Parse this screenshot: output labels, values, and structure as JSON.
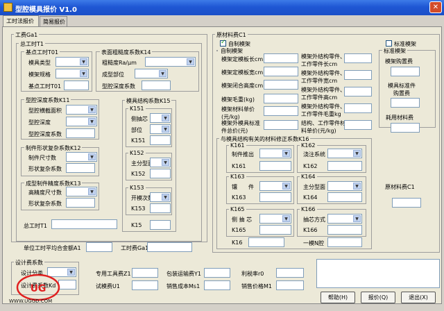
{
  "window": {
    "title": "型腔模具报价 V1.0",
    "close_glyph": "✕"
  },
  "tabs": [
    "工时法报价",
    "简易报价"
  ],
  "hours": {
    "group": "工费Ga1",
    "total": "总工时T1",
    "basic": {
      "group": "基点工时T01",
      "mold_type": "模具类型",
      "mold_spec": "模架规格",
      "base_hours": "基点工时T01"
    },
    "rough": {
      "group": "表面粗糙度系数K14",
      "roughness": "粗糙度Ra/μm",
      "cavity_part": "成型部位",
      "coef": "型腔深度系数"
    },
    "depth": {
      "group": "型腔深度系数K11",
      "area": "型腔横截面积",
      "depth": "型腔深度",
      "coef": "型腔深度系数"
    },
    "mfg": {
      "group": "制件形状复杂系数K12",
      "size": "制件尺寸数",
      "coef": "形状复杂系数"
    },
    "precision": {
      "group": "成型制件精度系数K13",
      "dims": "高精度尺寸数",
      "coef": "形状复杂系数"
    },
    "struct": {
      "group": "模具结构系数K15",
      "k151": {
        "group": "K151",
        "a": "侧抽芯",
        "b": "部位",
        "c": "K151"
      },
      "k152": {
        "group": "K152",
        "a": "主分型面",
        "b": "K152"
      },
      "k153": {
        "group": "K153",
        "a": "开模次数",
        "b": "K153"
      },
      "k15": "K15"
    },
    "total_label": "总工时T1",
    "avg_cost": "单位工时平均合金额A1",
    "fee_label": "工时费Ga1"
  },
  "material": {
    "group": "原材料费C1",
    "self_chk": "自制模架",
    "std_chk": "标准模架",
    "self": {
      "group": "自制模架",
      "len": "模架定模板长cm",
      "wid": "模架定模板宽cm",
      "h": "模架闭合高度cm",
      "wt": "模架毛重(kg)",
      "price": "模架材料单价(元/kg)",
      "total": "模架外模具标准件总价(元)"
    },
    "ext": {
      "len": "模架外结构零件、工作零件长cm",
      "wid": "模架外结构零件、工作零件宽cm",
      "h": "模架外结构零件、工作零件高cm",
      "wt": "模架外结构零件、工作零件毛重kg",
      "price": "结构、工作零件材料单价(元/kg)"
    },
    "std": {
      "group": "标准模架",
      "buy": "模架购置费",
      "parts": "模具标准件购置费",
      "use": "耗用材料费"
    },
    "k16": {
      "group": "与模具结构有关的材料修正系数K16",
      "k161": {
        "g": "K161",
        "a": "制件推出",
        "b": "K161"
      },
      "k162": {
        "g": "K162",
        "a": "浇注系统",
        "b": "K162"
      },
      "k163": {
        "g": "K163",
        "a": "镶　　件",
        "b": "K163"
      },
      "k164": {
        "g": "K164",
        "a": "主分型面",
        "b": "K164"
      },
      "k165": {
        "g": "K165",
        "a": "侧 抽 芯",
        "b": "K165"
      },
      "k166": {
        "g": "K166",
        "a": "抽芯方式",
        "b": "K166"
      },
      "k16": "K16",
      "cav": "一模N腔"
    },
    "fee": "原材料费C1"
  },
  "design": {
    "group": "设计费系数",
    "cls": "设计分类",
    "coef": "设计费系数Kd"
  },
  "bottom": {
    "tool": "专用工具费Z1",
    "pack": "包装运输费Y1",
    "profit": "利税率r0",
    "trial": "试模费U1",
    "sales": "销售成本Ms1",
    "price": "销售价格M1"
  },
  "buttons": {
    "help": "帮助(H)",
    "quote": "报价(Q)",
    "exit": "退出(X)"
  },
  "watermark": {
    "url": "WWW.UGGD.COM",
    "seal": "UG"
  }
}
